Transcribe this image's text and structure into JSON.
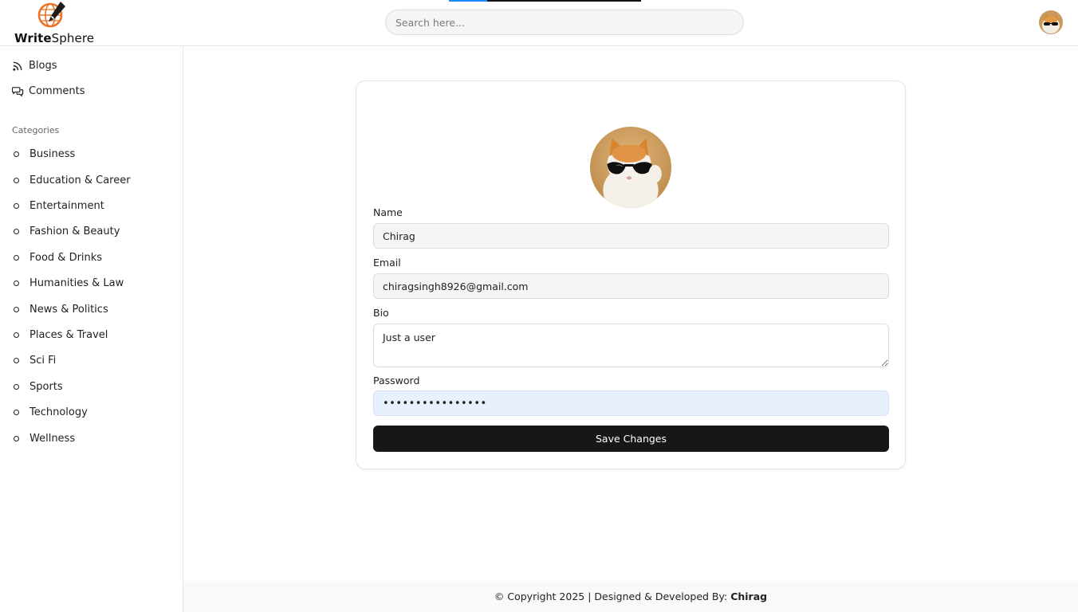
{
  "header": {
    "reading_progress": 0.2,
    "logo": {
      "bold": "Write",
      "rest": "Sphere",
      "icon": "globe-pen-icon"
    },
    "search": {
      "placeholder": "Search here...",
      "value": ""
    },
    "avatar": "user-avatar-cat"
  },
  "sidebar": {
    "nav": [
      {
        "label": "Blogs",
        "icon": "rss-icon"
      },
      {
        "label": "Comments",
        "icon": "comments-icon"
      }
    ],
    "categories_title": "Categories",
    "categories": [
      "Business",
      "Education & Career",
      "Entertainment",
      "Fashion & Beauty",
      "Food & Drinks",
      "Humanities & Law",
      "News & Politics",
      "Places & Travel",
      "Sci Fi",
      "Sports",
      "Technology",
      "Wellness"
    ]
  },
  "profile": {
    "avatar": "profile-avatar-cat-sunglasses",
    "name_label": "Name",
    "name_value": "Chirag",
    "email_label": "Email",
    "email_value": "chiragsingh8926@gmail.com",
    "bio_label": "Bio",
    "bio_value": "Just a user",
    "password_label": "Password",
    "password_value": "••••••••••••••••",
    "save_label": "Save Changes"
  },
  "footer": {
    "text": "© Copyright 2025 | Designed & Developed By:",
    "author": "Chirag"
  },
  "colors": {
    "brand_orange": "#e8742a",
    "button_dark": "#171717",
    "password_bg": "#e8f0fe",
    "progress_blue": "#1a8cff"
  }
}
